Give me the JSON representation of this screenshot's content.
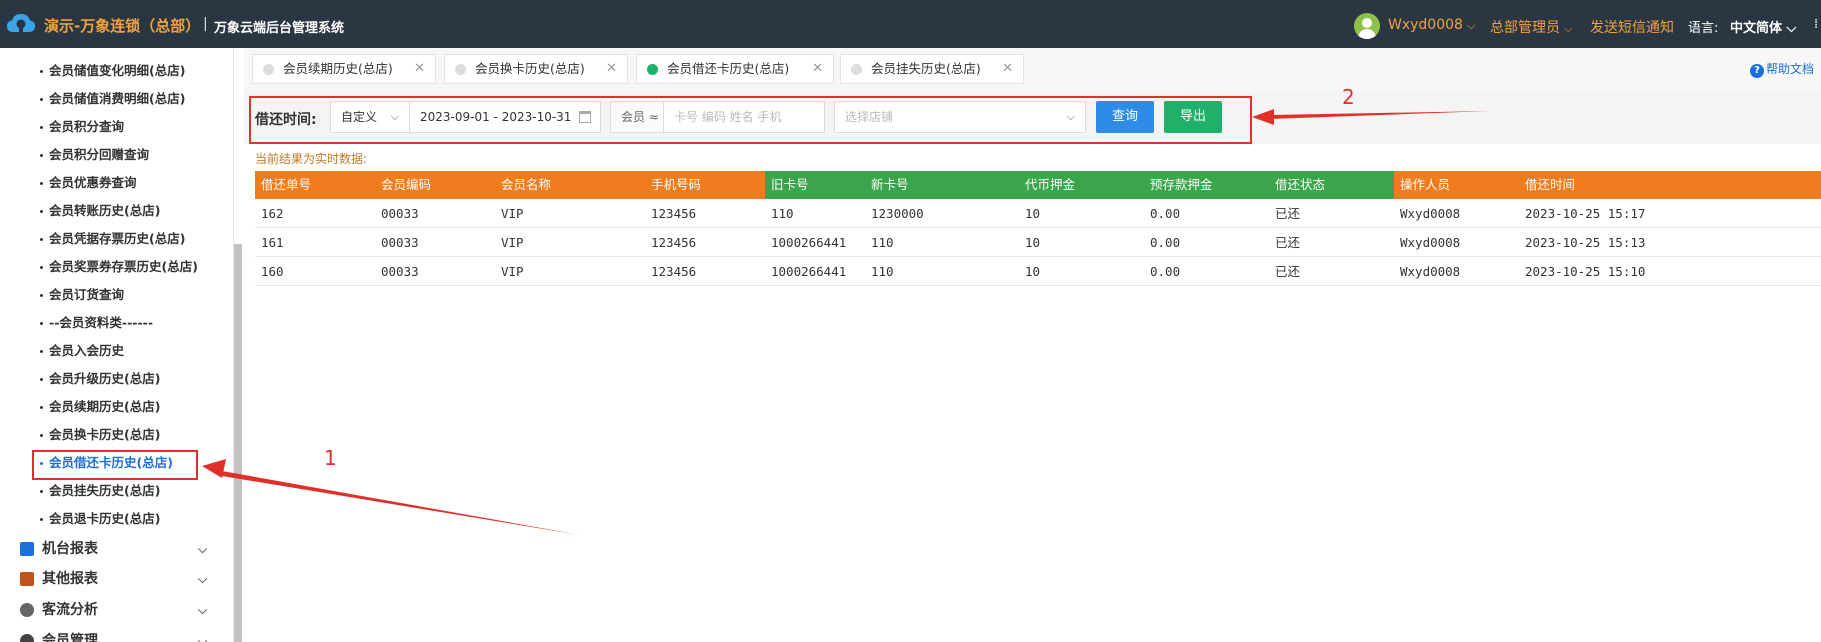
{
  "header": {
    "brand": "演示-万象连锁（总部）",
    "divider": "|",
    "system_name": "万象云端后台管理系统",
    "user": "Wxyd0008",
    "role": "总部管理员",
    "sms": "发送短信通知",
    "lang_label": "语言:",
    "lang_value": "中文简体"
  },
  "sidebar": {
    "items": [
      "会员储值变化明细(总店)",
      "会员储值消费明细(总店)",
      "会员积分查询",
      "会员积分回赠查询",
      "会员优惠券查询",
      "会员转账历史(总店)",
      "会员凭据存票历史(总店)",
      "会员奖票券存票历史(总店)",
      "会员订货查询",
      "--会员资料类------",
      "会员入会历史",
      "会员升级历史(总店)",
      "会员续期历史(总店)",
      "会员换卡历史(总店)",
      "会员借还卡历史(总店)",
      "会员挂失历史(总店)",
      "会员退卡历史(总店)"
    ],
    "active_index": 14,
    "groups": [
      "机台报表",
      "其他报表",
      "客流分析",
      "会员管理"
    ]
  },
  "tabs": [
    {
      "label": "会员续期历史(总店)",
      "active": false
    },
    {
      "label": "会员换卡历史(总店)",
      "active": false
    },
    {
      "label": "会员借还卡历史(总店)",
      "active": true
    },
    {
      "label": "会员挂失历史(总店)",
      "active": false
    }
  ],
  "help": "帮助文档",
  "filter": {
    "label": "借还时间:",
    "period": "自定义",
    "date_range": "2023-09-01 - 2023-10-31",
    "member_prefix": "会员 ≈",
    "member_placeholder": "卡号 编码 姓名 手机",
    "store_placeholder": "选择店铺",
    "query_button": "查询",
    "export_button": "导出"
  },
  "realtime_note": "当前结果为实时数据:",
  "table": {
    "columns": [
      "借还单号",
      "会员编码",
      "会员名称",
      "手机号码",
      "旧卡号",
      "新卡号",
      "代币押金",
      "预存款押金",
      "借还状态",
      "操作人员",
      "借还时间"
    ],
    "rows": [
      [
        "162",
        "00033",
        "VIP",
        "123456",
        "110",
        "1230000",
        "10",
        "0.00",
        "已还",
        "Wxyd0008",
        "2023-10-25 15:17"
      ],
      [
        "161",
        "00033",
        "VIP",
        "123456",
        "1000266441",
        "110",
        "10",
        "0.00",
        "已还",
        "Wxyd0008",
        "2023-10-25 15:13"
      ],
      [
        "160",
        "00033",
        "VIP",
        "123456",
        "1000266441",
        "110",
        "10",
        "0.00",
        "已还",
        "Wxyd0008",
        "2023-10-25 15:10"
      ]
    ]
  },
  "annotations": {
    "one": "1",
    "two": "2"
  },
  "colors": {
    "brand": "#f0a23b",
    "header_orange": "#f07c1e",
    "header_green": "#3aa54a",
    "highlight": "#e0302a"
  }
}
